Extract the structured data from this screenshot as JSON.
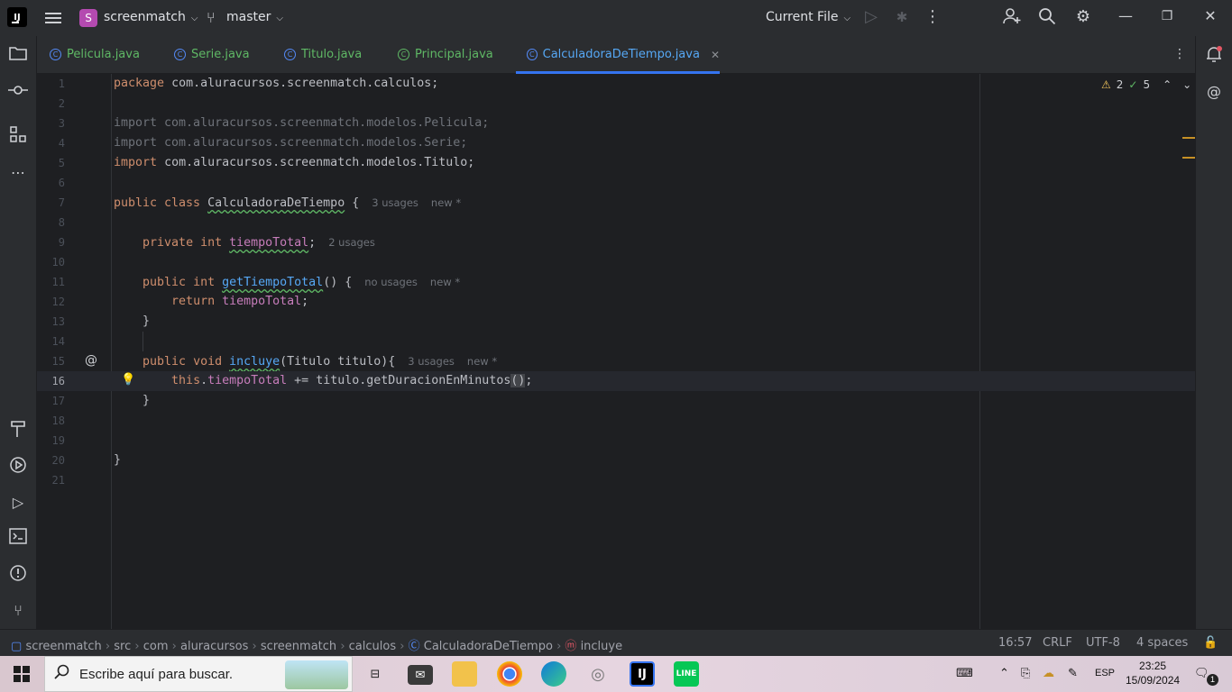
{
  "topbar": {
    "project_letter": "S",
    "project_name": "screenmatch",
    "branch": "master",
    "run_config": "Current File"
  },
  "tabs": [
    {
      "label": "Pelicula.java"
    },
    {
      "label": "Serie.java"
    },
    {
      "label": "Titulo.java"
    },
    {
      "label": "Principal.java"
    },
    {
      "label": "CalculadoraDeTiempo.java",
      "active": true
    }
  ],
  "editor": {
    "warnings": "2",
    "checks": "5",
    "line_numbers": [
      "1",
      "2",
      "3",
      "4",
      "5",
      "6",
      "7",
      "8",
      "9",
      "10",
      "11",
      "12",
      "13",
      "14",
      "15",
      "16",
      "17",
      "18",
      "19",
      "20",
      "21"
    ],
    "hints": {
      "class_usages": "3 usages",
      "class_new": "new *",
      "field_usages": "2 usages",
      "getter_usages": "no usages",
      "getter_new": "new *",
      "incluye_usages": "3 usages",
      "incluye_new": "new *"
    }
  },
  "breadcrumbs": [
    "screenmatch",
    "src",
    "com",
    "aluracursos",
    "screenmatch",
    "calculos",
    "CalculadoraDeTiempo",
    "incluye"
  ],
  "status": {
    "position": "16:57",
    "line_sep": "CRLF",
    "encoding": "UTF-8",
    "indent": "4 spaces"
  },
  "taskbar": {
    "search_placeholder": "Escribe aquí para buscar.",
    "lang": "ESP",
    "time": "23:25",
    "date": "15/09/2024",
    "notif_count": "1"
  }
}
